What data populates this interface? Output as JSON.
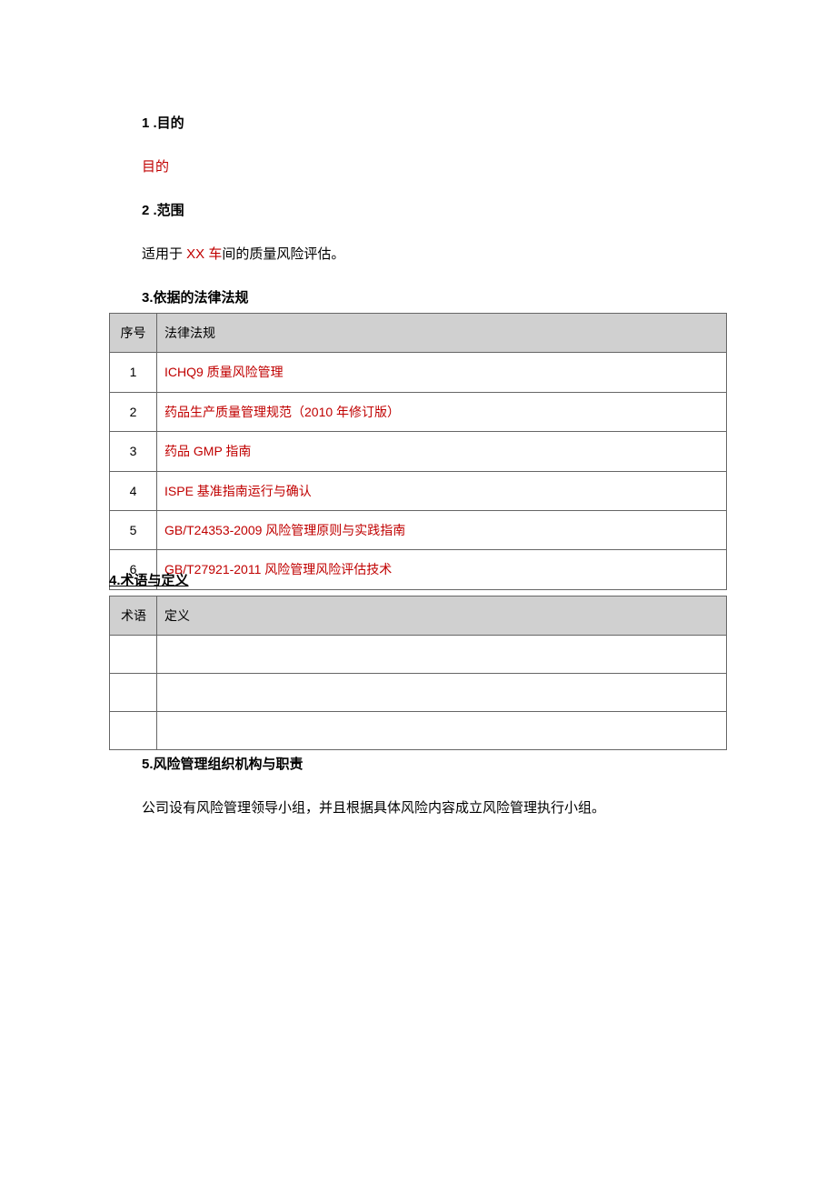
{
  "sections": {
    "s1_heading": "1 .目的",
    "s1_subtext": "目的",
    "s2_heading": "2 .范围",
    "s2_text_prefix": "适用于 ",
    "s2_text_red": "XX 车",
    "s2_text_suffix": "间的质量风险评估。",
    "s3_heading": "3.依据的法律法规",
    "s4_heading": "4.术语与定义",
    "s5_heading": "5.风险管理组织机构与职责",
    "s5_text": "公司设有风险管理领导小组，并且根据具体风险内容成立风险管理执行小组。"
  },
  "table1": {
    "headers": {
      "col1": "序号",
      "col2": "法律法规"
    },
    "rows": [
      {
        "seq": "1",
        "law": "ICHQ9 质量风险管理"
      },
      {
        "seq": "2",
        "law": "药品生产质量管理规范（2010 年修订版）"
      },
      {
        "seq": "3",
        "law": "药品 GMP 指南"
      },
      {
        "seq": "4",
        "law": "ISPE 基准指南运行与确认"
      },
      {
        "seq": "5",
        "law": "GB/T24353-2009 风险管理原则与实践指南"
      },
      {
        "seq": "6",
        "law": "GB/T27921-2011 风险管理风险评估技术"
      }
    ]
  },
  "table2": {
    "headers": {
      "col1": "术语",
      "col2": "定义"
    },
    "rows": [
      {
        "term": "",
        "def": ""
      },
      {
        "term": "",
        "def": ""
      },
      {
        "term": "",
        "def": ""
      }
    ]
  }
}
